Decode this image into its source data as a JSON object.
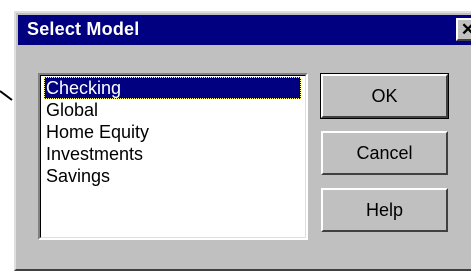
{
  "window": {
    "title": "Select Model",
    "close_glyph": "✕"
  },
  "models": [
    {
      "label": "Checking",
      "selected": true
    },
    {
      "label": "Global",
      "selected": false
    },
    {
      "label": "Home Equity",
      "selected": false
    },
    {
      "label": "Investments",
      "selected": false
    },
    {
      "label": "Savings",
      "selected": false
    }
  ],
  "buttons": {
    "ok": "OK",
    "cancel": "Cancel",
    "help": "Help"
  },
  "colors": {
    "titlebar": "#000080",
    "dialog_face": "#c0c0c0",
    "selection": "#000080"
  },
  "icons": {
    "close": "close-icon",
    "background_arrow": "arrow-cursor-icon"
  }
}
